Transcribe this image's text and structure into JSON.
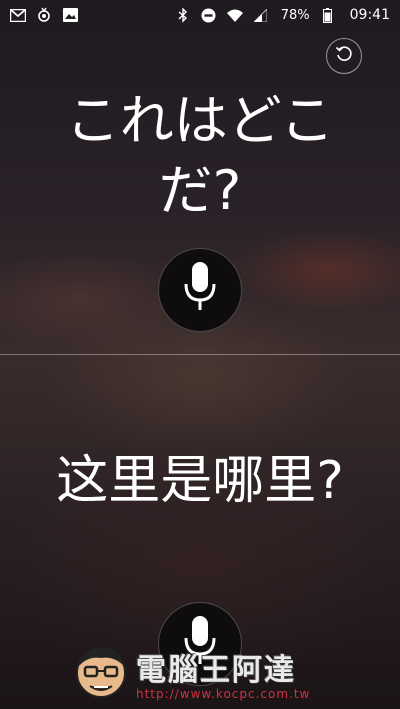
{
  "status_bar": {
    "left_icons": [
      "gmail-icon",
      "app-icon",
      "image-icon"
    ],
    "right_icons": [
      "bluetooth-icon",
      "dnd-icon",
      "wifi-icon",
      "signal-icon",
      "battery-icon"
    ],
    "battery": "78%",
    "time": "09:41"
  },
  "top_panel": {
    "phrase": "これはどこだ?",
    "reset_icon": "refresh-icon",
    "mic_icon": "microphone-icon"
  },
  "bottom_panel": {
    "phrase": "这里是哪里?",
    "mic_icon": "microphone-icon"
  },
  "watermark": {
    "brand": "電腦王阿達",
    "url": "http://www.kocpc.com.tw"
  },
  "colors": {
    "text": "#ffffff",
    "mic_button_bg": "#0f0c0e",
    "watermark_url": "#cc3344"
  }
}
